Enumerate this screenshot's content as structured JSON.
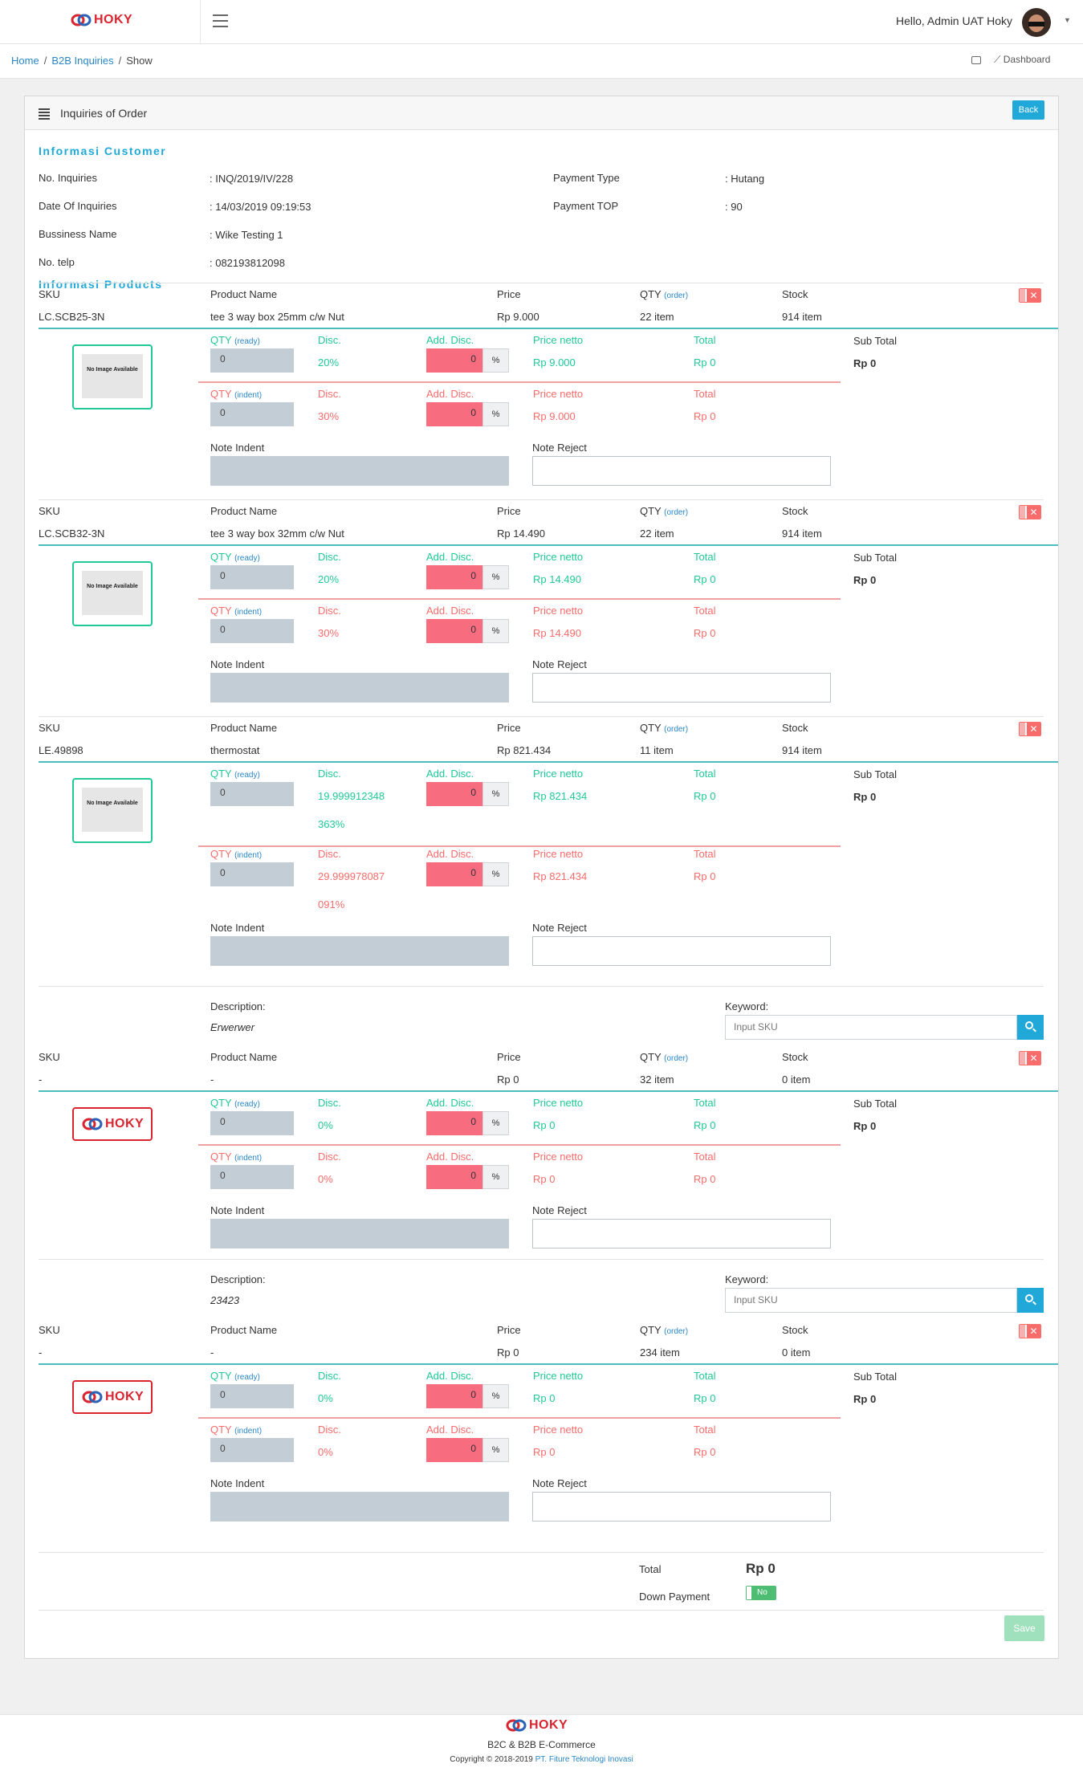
{
  "brand": {
    "logo_text": "HOKY",
    "brand_color": "#d9252f"
  },
  "header": {
    "greeting": "Hello, Admin UAT Hoky"
  },
  "breadcrumb": {
    "home": "Home",
    "section": "B2B Inquiries",
    "current": "Show",
    "dashboard": "Dashboard"
  },
  "card": {
    "title": "Inquiries of Order",
    "back_label": "Back"
  },
  "customer": {
    "heading": "Informasi Customer",
    "no_inquiries_label": "No. Inquiries",
    "no_inquiries": ": INQ/2019/IV/228",
    "date_label": "Date Of Inquiries",
    "date": ": 14/03/2019 09:19:53",
    "business_label": "Bussiness Name",
    "business": ": Wike Testing 1",
    "telp_label": "No. telp",
    "telp": ": 082193812098",
    "payment_type_label": "Payment Type",
    "payment_type": ": Hutang",
    "payment_top_label": "Payment TOP",
    "payment_top": ": 90"
  },
  "products_heading": "Informasi Products",
  "labels": {
    "sku": "SKU",
    "product_name": "Product Name",
    "price": "Price",
    "qty": "QTY",
    "order": "(order)",
    "stock": "Stock",
    "qty_ready": "QTY",
    "ready": "(ready)",
    "qty_indent": "QTY",
    "indent": "(indent)",
    "disc": "Disc.",
    "add_disc": "Add. Disc.",
    "price_netto": "Price netto",
    "total": "Total",
    "sub_total": "Sub Total",
    "note_indent": "Note Indent",
    "note_reject": "Note Reject",
    "percent": "%",
    "delete": "✕",
    "no_image": "No Image Available",
    "description": "Description:",
    "keyword": "Keyword:",
    "keyword_placeholder": "Input SKU"
  },
  "products": [
    {
      "sku": "LC.SCB25-3N",
      "name": "tee 3 way box 25mm c/w Nut",
      "price": "Rp 9.000",
      "qty": "22 item",
      "stock": "914 item",
      "ready_qty": "0",
      "ready_disc": "20%",
      "ready_add": "0",
      "ready_netto": "Rp 9.000",
      "ready_total": "Rp 0",
      "indent_qty": "0",
      "indent_disc": "30%",
      "indent_add": "0",
      "indent_netto": "Rp 9.000",
      "indent_total": "Rp 0",
      "sub_total": "Rp 0"
    },
    {
      "sku": "LC.SCB32-3N",
      "name": "tee 3 way box 32mm c/w Nut",
      "price": "Rp 14.490",
      "qty": "22 item",
      "stock": "914 item",
      "ready_qty": "0",
      "ready_disc": "20%",
      "ready_add": "0",
      "ready_netto": "Rp 14.490",
      "ready_total": "Rp 0",
      "indent_qty": "0",
      "indent_disc": "30%",
      "indent_add": "0",
      "indent_netto": "Rp 14.490",
      "indent_total": "Rp 0",
      "sub_total": "Rp 0"
    },
    {
      "sku": "LE.49898",
      "name": "thermostat",
      "price": "Rp 821.434",
      "qty": "11 item",
      "stock": "914 item",
      "ready_qty": "0",
      "ready_disc": "19.999912348",
      "ready_disc2": "363%",
      "ready_add": "0",
      "ready_netto": "Rp 821.434",
      "ready_total": "Rp 0",
      "indent_qty": "0",
      "indent_disc": "29.999978087",
      "indent_disc2": "091%",
      "indent_add": "0",
      "indent_netto": "Rp 821.434",
      "indent_total": "Rp 0",
      "sub_total": "Rp 0"
    },
    {
      "description": "Erwerwer",
      "sku": "-",
      "name": "-",
      "price": "Rp 0",
      "qty": "32 item",
      "stock": "0 item",
      "ready_qty": "0",
      "ready_disc": "0%",
      "ready_add": "0",
      "ready_netto": "Rp 0",
      "ready_total": "Rp 0",
      "indent_qty": "0",
      "indent_disc": "0%",
      "indent_add": "0",
      "indent_netto": "Rp 0",
      "indent_total": "Rp 0",
      "sub_total": "Rp 0"
    },
    {
      "description": "23423",
      "sku": "-",
      "name": "-",
      "price": "Rp 0",
      "qty": "234 item",
      "stock": "0 item",
      "ready_qty": "0",
      "ready_disc": "0%",
      "ready_add": "0",
      "ready_netto": "Rp 0",
      "ready_total": "Rp 0",
      "indent_qty": "0",
      "indent_disc": "0%",
      "indent_add": "0",
      "indent_netto": "Rp 0",
      "indent_total": "Rp 0",
      "sub_total": "Rp 0"
    }
  ],
  "summary": {
    "total_label": "Total",
    "total": "Rp 0",
    "dp_label": "Down Payment",
    "dp_toggle": "No",
    "save_label": "Save"
  },
  "footer": {
    "tagline": "B2C & B2B E-Commerce",
    "copyright": "Copyright © 2018-2019",
    "company": "PT. Fiture Teknologi Inovasi"
  },
  "colors": {
    "primary": "#20a8d8",
    "ready": "#20c997",
    "indent": "#f86c6b",
    "success": "#4dbd74"
  }
}
